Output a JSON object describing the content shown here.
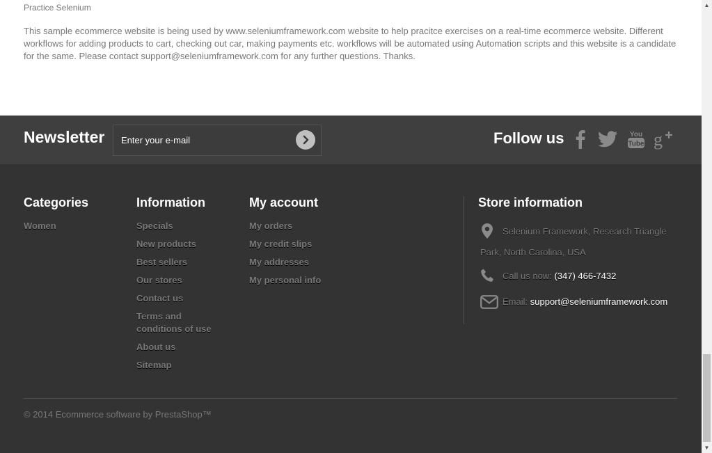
{
  "top": {
    "subtitle": "Practice Selenium",
    "description": "This sample ecommerce website is being used by www.seleniumframework.com website to help pracitce exercises on a real-time ecommerce website. Different workflows for adding products to cart, checking out car, making payments etc. workflows will be automated using Automation scripts and this website is a candidate for the same. Please contact support@seleniumframework.com for any further questions. Thanks."
  },
  "newsletter": {
    "title": "Newsletter",
    "placeholder": "Enter your e-mail",
    "submit_icon": "chevron-right-circle-icon"
  },
  "follow": {
    "title": "Follow us",
    "networks": [
      "facebook-icon",
      "twitter-icon",
      "youtube-icon",
      "google-plus-icon"
    ]
  },
  "categories": {
    "title": "Categories",
    "items": [
      "Women"
    ]
  },
  "information": {
    "title": "Information",
    "items": [
      "Specials",
      "New products",
      "Best sellers",
      "Our stores",
      "Contact us",
      "Terms and conditions of use",
      "About us",
      "Sitemap"
    ]
  },
  "account": {
    "title": "My account",
    "items": [
      "My orders",
      "My credit slips",
      "My addresses",
      "My personal info"
    ]
  },
  "store": {
    "title": "Store information",
    "address": "Selenium Framework, Research Triangle Park, North Carolina, USA",
    "phone_label": "Call us now:",
    "phone": "(347) 466-7432",
    "email_label": "Email:",
    "email": "support@seleniumframework.com"
  },
  "copyright": "© 2014 Ecommerce software by PrestaShop™",
  "colors": {
    "newsletter_bg": "#3f3f3f",
    "footer_bg": "#333333",
    "link_gray": "#777777",
    "white": "#ffffff"
  }
}
